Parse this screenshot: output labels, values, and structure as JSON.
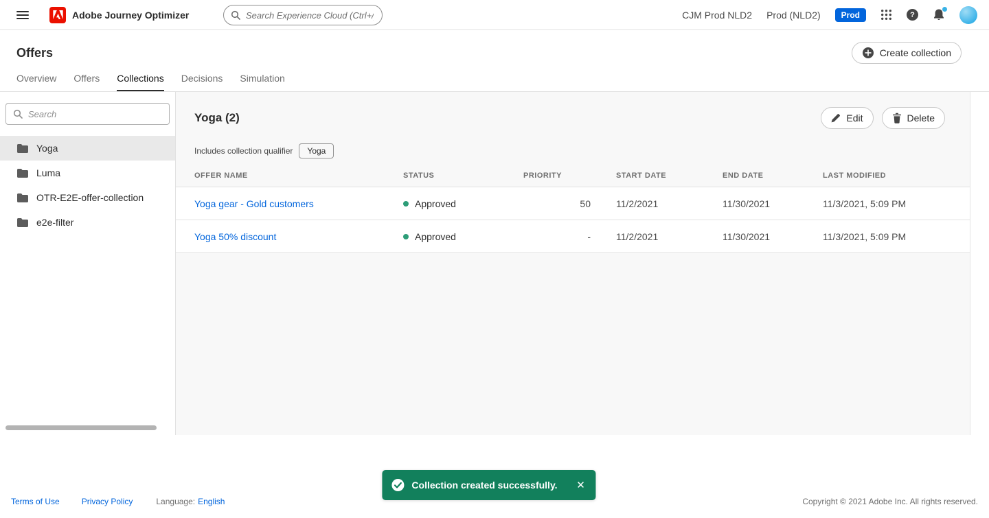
{
  "topbar": {
    "app_title": "Adobe Journey Optimizer",
    "search_placeholder": "Search Experience Cloud (Ctrl+/)",
    "org_name": "CJM Prod NLD2",
    "sandbox_name": "Prod (NLD2)",
    "sandbox_badge": "Prod"
  },
  "page": {
    "title": "Offers",
    "create_collection_label": "Create collection"
  },
  "tabs": [
    {
      "label": "Overview"
    },
    {
      "label": "Offers"
    },
    {
      "label": "Collections"
    },
    {
      "label": "Decisions"
    },
    {
      "label": "Simulation"
    }
  ],
  "sidebar": {
    "search_placeholder": "Search",
    "folders": [
      {
        "label": "Yoga"
      },
      {
        "label": "Luma"
      },
      {
        "label": "OTR-E2E-offer-collection"
      },
      {
        "label": "e2e-filter"
      }
    ]
  },
  "collection": {
    "title": "Yoga (2)",
    "edit_label": "Edit",
    "delete_label": "Delete",
    "qualifier_label": "Includes collection qualifier",
    "qualifier_value": "Yoga"
  },
  "table": {
    "headers": {
      "name": "OFFER NAME",
      "status": "STATUS",
      "priority": "PRIORITY",
      "start": "START DATE",
      "end": "END DATE",
      "modified": "LAST MODIFIED"
    },
    "rows": [
      {
        "name": "Yoga gear - Gold customers",
        "status": "Approved",
        "priority": "50",
        "start": "11/2/2021",
        "end": "11/30/2021",
        "modified": "11/3/2021, 5:09 PM"
      },
      {
        "name": "Yoga 50% discount",
        "status": "Approved",
        "priority": "-",
        "start": "11/2/2021",
        "end": "11/30/2021",
        "modified": "11/3/2021, 5:09 PM"
      }
    ]
  },
  "toast": {
    "message": "Collection created successfully.",
    "close_symbol": "✕"
  },
  "footer": {
    "terms": "Terms of Use",
    "privacy": "Privacy Policy",
    "language_label": "Language:",
    "language_value": "English",
    "copyright": "Copyright  ©  2021 Adobe Inc.  All rights reserved."
  },
  "colors": {
    "accent_blue": "#0265dc",
    "adobe_red": "#eb1000",
    "toast_green": "#12805c",
    "status_green": "#2d9d78",
    "badge_blue": "#0265dc"
  }
}
